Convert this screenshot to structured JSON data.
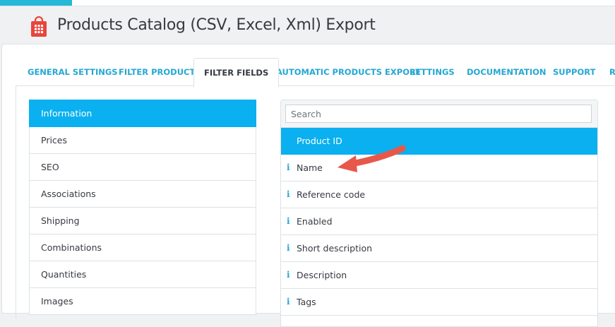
{
  "header": {
    "title": "Products Catalog (CSV, Excel, Xml) Export",
    "logo": "shopping-bag-icon"
  },
  "tabs": [
    {
      "label": "GENERAL SETTINGS"
    },
    {
      "label": "FILTER PRODUCTS"
    },
    {
      "label": "FILTER FIELDS",
      "active": true
    },
    {
      "label": "AUTOMATIC PRODUCTS EXPORT"
    },
    {
      "label": "SETTINGS"
    },
    {
      "label": "DOCUMENTATION"
    },
    {
      "label": "SUPPORT"
    },
    {
      "label": "RE"
    }
  ],
  "left_menu": [
    {
      "label": "Information",
      "active": true
    },
    {
      "label": "Prices"
    },
    {
      "label": "SEO"
    },
    {
      "label": "Associations"
    },
    {
      "label": "Shipping"
    },
    {
      "label": "Combinations"
    },
    {
      "label": "Quantities"
    },
    {
      "label": "Images"
    }
  ],
  "fields": {
    "search_placeholder": "Search",
    "items": [
      {
        "label": "Product ID",
        "active": true
      },
      {
        "label": "Name"
      },
      {
        "label": "Reference code"
      },
      {
        "label": "Enabled"
      },
      {
        "label": "Short description"
      },
      {
        "label": "Description"
      },
      {
        "label": "Tags"
      }
    ],
    "info_icon": "info-icon"
  },
  "colors": {
    "accent": "#25b9d7",
    "active": "#0ab0ef",
    "arrow": "#e8584a"
  }
}
